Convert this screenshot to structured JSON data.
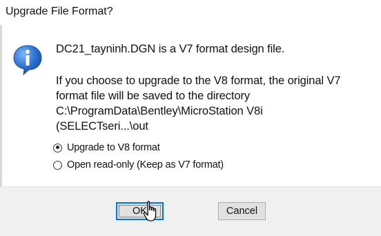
{
  "window": {
    "title": "Upgrade File Format?"
  },
  "message": {
    "line1": "DC21_tayninh.DGN is a V7 format design file.",
    "line2": "If you choose to upgrade to the V8 format, the original V7",
    "line3": "format file will be saved to the directory",
    "line4": "C:\\ProgramData\\Bentley\\MicroStation V8i",
    "line5": "(SELECTseri...\\out"
  },
  "options": [
    {
      "label": "Upgrade to V8 format",
      "selected": true
    },
    {
      "label": "Open read-only (Keep as V7 format)",
      "selected": false
    }
  ],
  "buttons": {
    "ok_label": "OK",
    "cancel_label": "Cancel"
  },
  "icons": {
    "info": "information-icon",
    "cursor": "mouse-cursor-icon"
  },
  "colors": {
    "accent": "#0078d7",
    "info_icon": "#2b6fcf",
    "footer_bg": "#f0f0f0"
  }
}
